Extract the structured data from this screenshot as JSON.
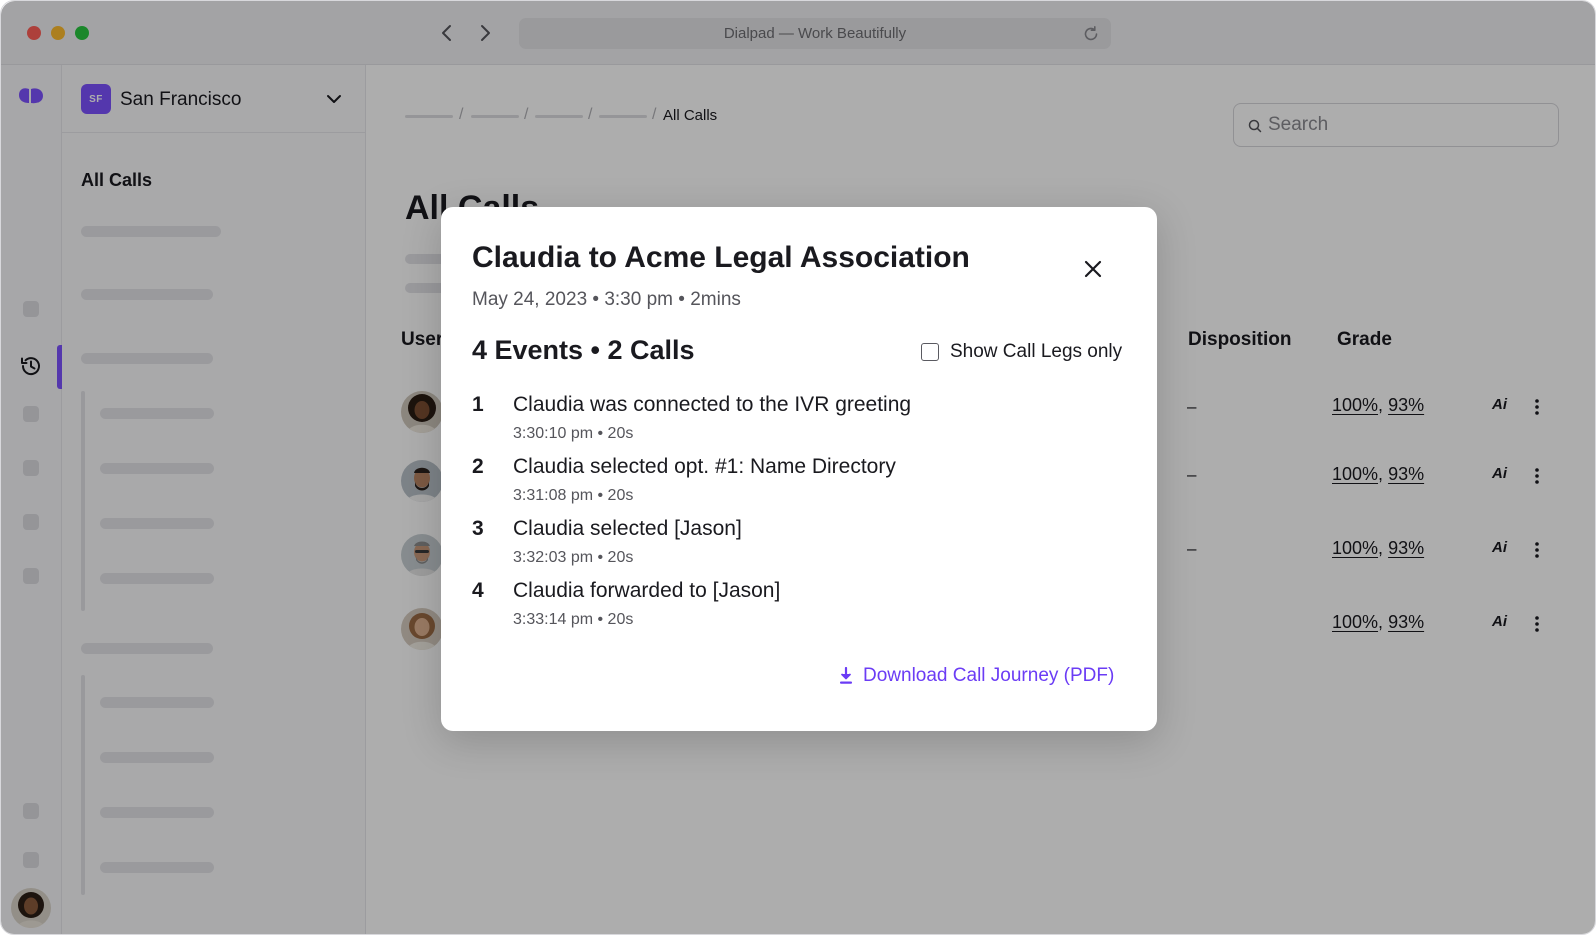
{
  "window": {
    "url_title": "Dialpad — Work Beautifully"
  },
  "colors": {
    "accent": "#7c52ff",
    "link": "#6b3cf5"
  },
  "sidebar": {
    "office_badge": "SF",
    "office_name": "San Francisco",
    "heading": "All Calls"
  },
  "main": {
    "breadcrumb_current": "All Calls",
    "search_placeholder": "Search",
    "page_title": "All Calls",
    "columns": {
      "user": "User",
      "disposition": "Disposition",
      "grade": "Grade"
    },
    "rows": [
      {
        "disposition": "–",
        "grade_a": "100%",
        "grade_b": "93%"
      },
      {
        "disposition": "–",
        "grade_a": "100%",
        "grade_b": "93%"
      },
      {
        "disposition": "–",
        "grade_a": "100%",
        "grade_b": "93%"
      },
      {
        "disposition": "",
        "grade_a": "100%",
        "grade_b": "93%"
      }
    ],
    "grade_separator": ","
  },
  "modal": {
    "title": "Claudia to Acme Legal Association",
    "meta": "May 24, 2023 • 3:30 pm • 2mins",
    "summary": "4 Events • 2 Calls",
    "legs_toggle_label": "Show Call Legs only",
    "events": [
      {
        "num": "1",
        "text": "Claudia was connected to the IVR greeting",
        "time": "3:30:10 pm • 20s"
      },
      {
        "num": "2",
        "text": "Claudia selected opt. #1: Name Directory",
        "time": "3:31:08 pm • 20s"
      },
      {
        "num": "3",
        "text": "Claudia selected [Jason]",
        "time": "3:32:03 pm • 20s"
      },
      {
        "num": "4",
        "text": "Claudia forwarded to [Jason]",
        "time": "3:33:14 pm • 20s"
      }
    ],
    "download_label": "Download Call Journey (PDF)"
  }
}
